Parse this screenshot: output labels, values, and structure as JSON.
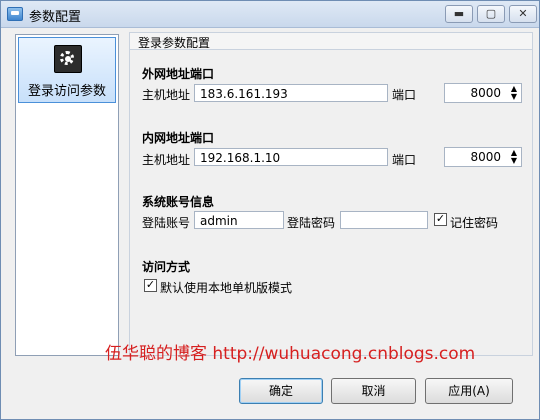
{
  "window": {
    "title": "参数配置"
  },
  "titlebar_buttons": {
    "minimize": "▬",
    "maximize": "▢",
    "close": "✕"
  },
  "sidebar": {
    "items": [
      {
        "label": "登录访问参数",
        "icon": "gear-icon"
      }
    ]
  },
  "content": {
    "header": "登录参数配置",
    "external": {
      "section": "外网地址端口",
      "host_label": "主机地址",
      "host_value": "183.6.161.193",
      "port_label": "端口",
      "port_value": "8000"
    },
    "internal": {
      "section": "内网地址端口",
      "host_label": "主机地址",
      "host_value": "192.168.1.10",
      "port_label": "端口",
      "port_value": "8000"
    },
    "account": {
      "section": "系统账号信息",
      "user_label": "登陆账号",
      "user_value": "admin",
      "password_label": "登陆密码",
      "password_value": "",
      "remember_label": "记住密码",
      "remember_checked": "✓"
    },
    "access": {
      "section": "访问方式",
      "standalone_label": "默认使用本地单机版模式",
      "standalone_checked": "✓"
    }
  },
  "watermark": "伍华聪的博客  http://wuhuacong.cnblogs.com",
  "buttons": {
    "ok": "确定",
    "cancel": "取消",
    "apply": "应用(A)"
  }
}
